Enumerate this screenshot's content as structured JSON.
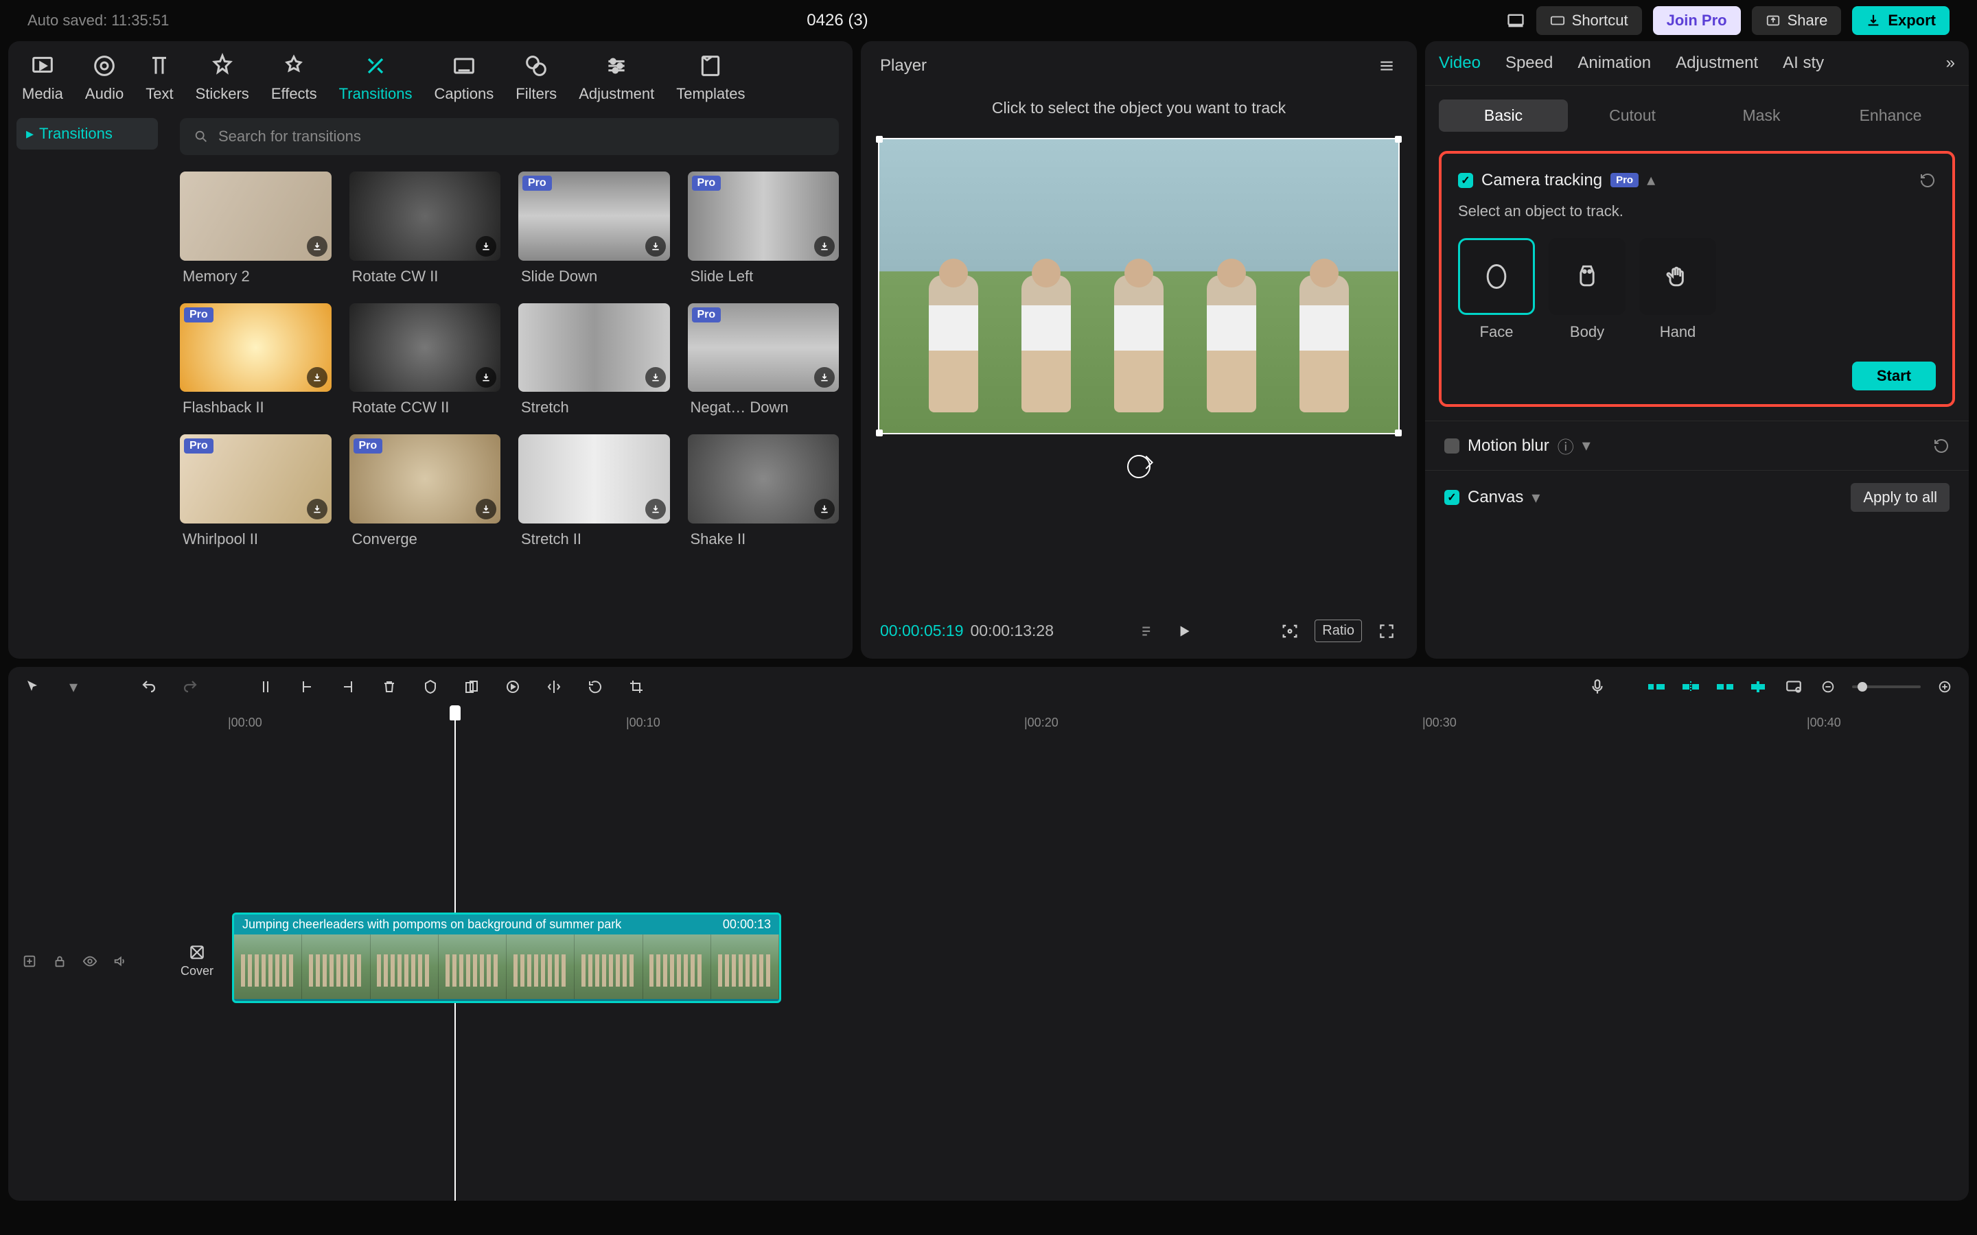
{
  "titlebar": {
    "autosave": "Auto saved: 11:35:51",
    "title": "0426 (3)",
    "shortcut": "Shortcut",
    "joinpro": "Join Pro",
    "share": "Share",
    "export": "Export"
  },
  "toolTabs": [
    {
      "label": "Media"
    },
    {
      "label": "Audio"
    },
    {
      "label": "Text"
    },
    {
      "label": "Stickers"
    },
    {
      "label": "Effects"
    },
    {
      "label": "Transitions"
    },
    {
      "label": "Captions"
    },
    {
      "label": "Filters"
    },
    {
      "label": "Adjustment"
    },
    {
      "label": "Templates"
    }
  ],
  "activeToolIndex": 5,
  "sideList": {
    "item": "Transitions"
  },
  "search": {
    "placeholder": "Search for transitions"
  },
  "thumbs": [
    {
      "label": "Memory 2",
      "pro": false
    },
    {
      "label": "Rotate CW II",
      "pro": false
    },
    {
      "label": "Slide Down",
      "pro": true
    },
    {
      "label": "Slide Left",
      "pro": true
    },
    {
      "label": "Flashback II",
      "pro": true
    },
    {
      "label": "Rotate CCW II",
      "pro": false
    },
    {
      "label": "Stretch",
      "pro": false
    },
    {
      "label": "Negat… Down",
      "pro": true
    },
    {
      "label": "Whirlpool II",
      "pro": true
    },
    {
      "label": "Converge",
      "pro": true
    },
    {
      "label": "Stretch II",
      "pro": false
    },
    {
      "label": "Shake II",
      "pro": false
    }
  ],
  "player": {
    "title": "Player",
    "hint": "Click to select the object you want to track",
    "current": "00:00:05:19",
    "duration": "00:00:13:28",
    "ratio": "Ratio"
  },
  "rightTabs": [
    "Video",
    "Speed",
    "Animation",
    "Adjustment",
    "AI sty"
  ],
  "rightActive": 0,
  "subTabs": [
    "Basic",
    "Cutout",
    "Mask",
    "Enhance"
  ],
  "subActive": 0,
  "tracking": {
    "title": "Camera tracking",
    "pro": "Pro",
    "select": "Select an object to track.",
    "opts": [
      "Face",
      "Body",
      "Hand"
    ],
    "selected": 0,
    "start": "Start"
  },
  "motionBlur": "Motion blur",
  "canvas": "Canvas",
  "applyAll": "Apply to all",
  "ruler": [
    "|00:00",
    "|00:10",
    "|00:20",
    "|00:30",
    "|00:40"
  ],
  "clip": {
    "name": "Jumping cheerleaders with pompoms on background of summer park",
    "dur": "00:00:13"
  },
  "cover": "Cover"
}
